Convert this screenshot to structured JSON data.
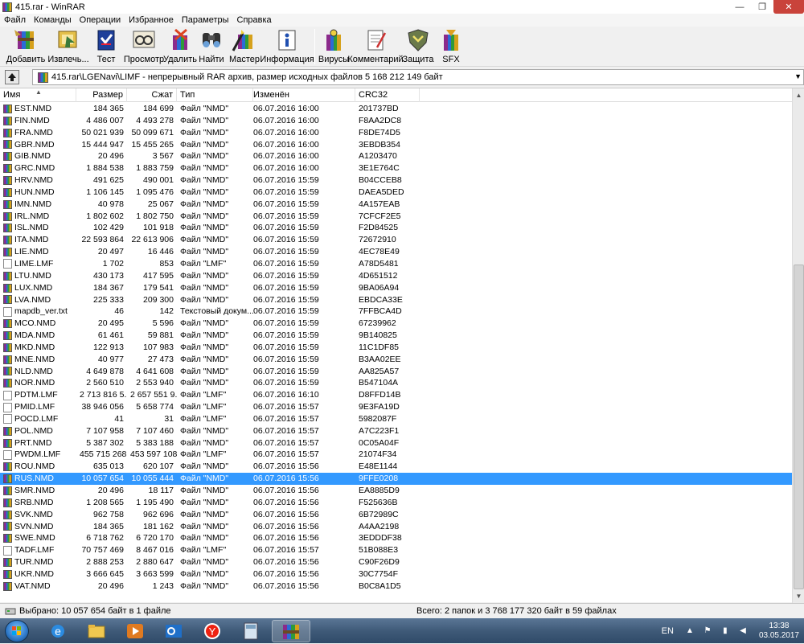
{
  "window": {
    "title": "415.rar - WinRAR",
    "controls": {
      "minimize": "—",
      "maximize": "❐",
      "close": "✕"
    }
  },
  "menu": [
    "Файл",
    "Команды",
    "Операции",
    "Избранное",
    "Параметры",
    "Справка"
  ],
  "toolbar": [
    {
      "label": "Добавить",
      "icon": "add-archive-icon"
    },
    {
      "label": "Извлечь...",
      "icon": "extract-icon"
    },
    {
      "label": "Тест",
      "icon": "test-icon"
    },
    {
      "label": "Просмотр",
      "icon": "view-icon"
    },
    {
      "label": "Удалить",
      "icon": "delete-icon"
    },
    {
      "label": "Найти",
      "icon": "find-icon"
    },
    {
      "label": "Мастер",
      "icon": "wizard-icon"
    },
    {
      "label": "Информация",
      "icon": "info-icon"
    },
    {
      "label": "Вирусы",
      "icon": "virus-scan-icon"
    },
    {
      "label": "Комментарий",
      "icon": "comment-icon"
    },
    {
      "label": "Защита",
      "icon": "protect-icon"
    },
    {
      "label": "SFX",
      "icon": "sfx-icon"
    }
  ],
  "address": {
    "path": "415.rar\\LGENavi\\LIMF - непрерывный RAR архив, размер исходных файлов 5 168 212 149 байт"
  },
  "columns": {
    "name": "Имя",
    "size": "Размер",
    "packed": "Сжат",
    "type": "Тип",
    "modified": "Изменён",
    "crc": "CRC32"
  },
  "files": [
    {
      "name": "EST.NMD",
      "size": "184 365",
      "packed": "184 699",
      "type": "Файл \"NMD\"",
      "modified": "06.07.2016 16:00",
      "crc": "201737BD",
      "icon": "rar"
    },
    {
      "name": "FIN.NMD",
      "size": "4 486 007",
      "packed": "4 493 278",
      "type": "Файл \"NMD\"",
      "modified": "06.07.2016 16:00",
      "crc": "F8AA2DC8",
      "icon": "rar"
    },
    {
      "name": "FRA.NMD",
      "size": "50 021 939",
      "packed": "50 099 671",
      "type": "Файл \"NMD\"",
      "modified": "06.07.2016 16:00",
      "crc": "F8DE74D5",
      "icon": "rar"
    },
    {
      "name": "GBR.NMD",
      "size": "15 444 947",
      "packed": "15 455 265",
      "type": "Файл \"NMD\"",
      "modified": "06.07.2016 16:00",
      "crc": "3EBDB354",
      "icon": "rar"
    },
    {
      "name": "GIB.NMD",
      "size": "20 496",
      "packed": "3 567",
      "type": "Файл \"NMD\"",
      "modified": "06.07.2016 16:00",
      "crc": "A1203470",
      "icon": "rar"
    },
    {
      "name": "GRC.NMD",
      "size": "1 884 538",
      "packed": "1 883 759",
      "type": "Файл \"NMD\"",
      "modified": "06.07.2016 16:00",
      "crc": "3E1E764C",
      "icon": "rar"
    },
    {
      "name": "HRV.NMD",
      "size": "491 625",
      "packed": "490 001",
      "type": "Файл \"NMD\"",
      "modified": "06.07.2016 15:59",
      "crc": "B04CCEB8",
      "icon": "rar"
    },
    {
      "name": "HUN.NMD",
      "size": "1 106 145",
      "packed": "1 095 476",
      "type": "Файл \"NMD\"",
      "modified": "06.07.2016 15:59",
      "crc": "DAEA5DED",
      "icon": "rar"
    },
    {
      "name": "IMN.NMD",
      "size": "40 978",
      "packed": "25 067",
      "type": "Файл \"NMD\"",
      "modified": "06.07.2016 15:59",
      "crc": "4A157EAB",
      "icon": "rar"
    },
    {
      "name": "IRL.NMD",
      "size": "1 802 602",
      "packed": "1 802 750",
      "type": "Файл \"NMD\"",
      "modified": "06.07.2016 15:59",
      "crc": "7CFCF2E5",
      "icon": "rar"
    },
    {
      "name": "ISL.NMD",
      "size": "102 429",
      "packed": "101 918",
      "type": "Файл \"NMD\"",
      "modified": "06.07.2016 15:59",
      "crc": "F2D84525",
      "icon": "rar"
    },
    {
      "name": "ITA.NMD",
      "size": "22 593 864",
      "packed": "22 613 906",
      "type": "Файл \"NMD\"",
      "modified": "06.07.2016 15:59",
      "crc": "72672910",
      "icon": "rar"
    },
    {
      "name": "LIE.NMD",
      "size": "20 497",
      "packed": "16 446",
      "type": "Файл \"NMD\"",
      "modified": "06.07.2016 15:59",
      "crc": "4EC78E49",
      "icon": "rar"
    },
    {
      "name": "LIME.LMF",
      "size": "1 702",
      "packed": "853",
      "type": "Файл \"LMF\"",
      "modified": "06.07.2016 15:59",
      "crc": "A78D5481",
      "icon": "doc"
    },
    {
      "name": "LTU.NMD",
      "size": "430 173",
      "packed": "417 595",
      "type": "Файл \"NMD\"",
      "modified": "06.07.2016 15:59",
      "crc": "4D651512",
      "icon": "rar"
    },
    {
      "name": "LUX.NMD",
      "size": "184 367",
      "packed": "179 541",
      "type": "Файл \"NMD\"",
      "modified": "06.07.2016 15:59",
      "crc": "9BA06A94",
      "icon": "rar"
    },
    {
      "name": "LVA.NMD",
      "size": "225 333",
      "packed": "209 300",
      "type": "Файл \"NMD\"",
      "modified": "06.07.2016 15:59",
      "crc": "EBDCA33E",
      "icon": "rar"
    },
    {
      "name": "mapdb_ver.txt",
      "size": "46",
      "packed": "142",
      "type": "Текстовый докум...",
      "modified": "06.07.2016 15:59",
      "crc": "7FFBCA4D",
      "icon": "doc"
    },
    {
      "name": "MCO.NMD",
      "size": "20 495",
      "packed": "5 596",
      "type": "Файл \"NMD\"",
      "modified": "06.07.2016 15:59",
      "crc": "67239962",
      "icon": "rar"
    },
    {
      "name": "MDA.NMD",
      "size": "61 461",
      "packed": "59 881",
      "type": "Файл \"NMD\"",
      "modified": "06.07.2016 15:59",
      "crc": "9B140825",
      "icon": "rar"
    },
    {
      "name": "MKD.NMD",
      "size": "122 913",
      "packed": "107 983",
      "type": "Файл \"NMD\"",
      "modified": "06.07.2016 15:59",
      "crc": "11C1DF85",
      "icon": "rar"
    },
    {
      "name": "MNE.NMD",
      "size": "40 977",
      "packed": "27 473",
      "type": "Файл \"NMD\"",
      "modified": "06.07.2016 15:59",
      "crc": "B3AA02EE",
      "icon": "rar"
    },
    {
      "name": "NLD.NMD",
      "size": "4 649 878",
      "packed": "4 641 608",
      "type": "Файл \"NMD\"",
      "modified": "06.07.2016 15:59",
      "crc": "AA825A57",
      "icon": "rar"
    },
    {
      "name": "NOR.NMD",
      "size": "2 560 510",
      "packed": "2 553 940",
      "type": "Файл \"NMD\"",
      "modified": "06.07.2016 15:59",
      "crc": "B547104A",
      "icon": "rar"
    },
    {
      "name": "PDTM.LMF",
      "size": "2 713 816 5...",
      "packed": "2 657 551 9...",
      "type": "Файл \"LMF\"",
      "modified": "06.07.2016 16:10",
      "crc": "D8FFD14B",
      "icon": "doc"
    },
    {
      "name": "PMID.LMF",
      "size": "38 946 056",
      "packed": "5 658 774",
      "type": "Файл \"LMF\"",
      "modified": "06.07.2016 15:57",
      "crc": "9E3FA19D",
      "icon": "doc"
    },
    {
      "name": "POCD.LMF",
      "size": "41",
      "packed": "31",
      "type": "Файл \"LMF\"",
      "modified": "06.07.2016 15:57",
      "crc": "5982087F",
      "icon": "doc"
    },
    {
      "name": "POL.NMD",
      "size": "7 107 958",
      "packed": "7 107 460",
      "type": "Файл \"NMD\"",
      "modified": "06.07.2016 15:57",
      "crc": "A7C223F1",
      "icon": "rar"
    },
    {
      "name": "PRT.NMD",
      "size": "5 387 302",
      "packed": "5 383 188",
      "type": "Файл \"NMD\"",
      "modified": "06.07.2016 15:57",
      "crc": "0C05A04F",
      "icon": "rar"
    },
    {
      "name": "PWDM.LMF",
      "size": "455 715 268",
      "packed": "453 597 108",
      "type": "Файл \"LMF\"",
      "modified": "06.07.2016 15:57",
      "crc": "21074F34",
      "icon": "doc"
    },
    {
      "name": "ROU.NMD",
      "size": "635 013",
      "packed": "620 107",
      "type": "Файл \"NMD\"",
      "modified": "06.07.2016 15:56",
      "crc": "E48E1144",
      "icon": "rar"
    },
    {
      "name": "RUS.NMD",
      "size": "10 057 654",
      "packed": "10 055 444",
      "type": "Файл \"NMD\"",
      "modified": "06.07.2016 15:56",
      "crc": "9FFE0208",
      "icon": "rar",
      "selected": true
    },
    {
      "name": "SMR.NMD",
      "size": "20 496",
      "packed": "18 117",
      "type": "Файл \"NMD\"",
      "modified": "06.07.2016 15:56",
      "crc": "EA8885D9",
      "icon": "rar"
    },
    {
      "name": "SRB.NMD",
      "size": "1 208 565",
      "packed": "1 195 490",
      "type": "Файл \"NMD\"",
      "modified": "06.07.2016 15:56",
      "crc": "F525636B",
      "icon": "rar"
    },
    {
      "name": "SVK.NMD",
      "size": "962 758",
      "packed": "962 696",
      "type": "Файл \"NMD\"",
      "modified": "06.07.2016 15:56",
      "crc": "6B72989C",
      "icon": "rar"
    },
    {
      "name": "SVN.NMD",
      "size": "184 365",
      "packed": "181 162",
      "type": "Файл \"NMD\"",
      "modified": "06.07.2016 15:56",
      "crc": "A4AA2198",
      "icon": "rar"
    },
    {
      "name": "SWE.NMD",
      "size": "6 718 762",
      "packed": "6 720 170",
      "type": "Файл \"NMD\"",
      "modified": "06.07.2016 15:56",
      "crc": "3EDDDF38",
      "icon": "rar"
    },
    {
      "name": "TADF.LMF",
      "size": "70 757 469",
      "packed": "8 467 016",
      "type": "Файл \"LMF\"",
      "modified": "06.07.2016 15:57",
      "crc": "51B088E3",
      "icon": "doc"
    },
    {
      "name": "TUR.NMD",
      "size": "2 888 253",
      "packed": "2 880 647",
      "type": "Файл \"NMD\"",
      "modified": "06.07.2016 15:56",
      "crc": "C90F26D9",
      "icon": "rar"
    },
    {
      "name": "UKR.NMD",
      "size": "3 666 645",
      "packed": "3 663 599",
      "type": "Файл \"NMD\"",
      "modified": "06.07.2016 15:56",
      "crc": "30C7754F",
      "icon": "rar"
    },
    {
      "name": "VAT.NMD",
      "size": "20 496",
      "packed": "1 243",
      "type": "Файл \"NMD\"",
      "modified": "06.07.2016 15:56",
      "crc": "B0C8A1D5",
      "icon": "rar"
    }
  ],
  "status": {
    "selected": "Выбрано: 10 057 654 байт в 1 файле",
    "total": "Всего: 2 папок и 3 768 177 320 байт в 59 файлах"
  },
  "taskbar": {
    "language": "EN",
    "time": "13:38",
    "date": "03.05.2017"
  },
  "colors": {
    "selection": "#3399ff",
    "close_button": "#c9433b"
  }
}
